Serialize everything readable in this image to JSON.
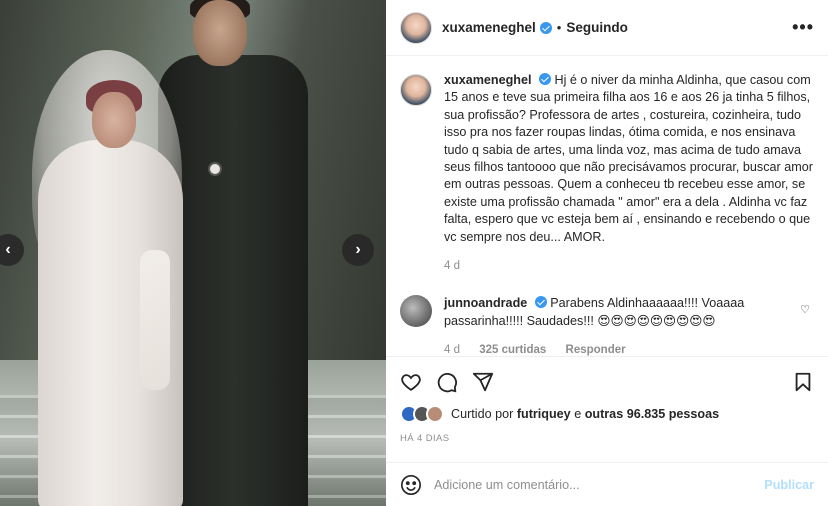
{
  "post": {
    "author": "xuxameneghel",
    "follow_status": "Seguindo",
    "separator": "•",
    "more": "•••",
    "nav_prev": "‹",
    "nav_next": "›"
  },
  "caption": {
    "author": "xuxameneghel",
    "text": "Hj é o niver da minha Aldinha, que casou com 15 anos e teve sua primeira filha aos 16 e aos 26 ja tinha 5 filhos, sua profissão? Professora de artes , costureira, cozinheira, tudo isso pra nos fazer roupas lindas, ótima comida, e nos ensinava tudo q sabia de artes, uma linda voz, mas acima de tudo amava seus filhos tantoooo que não precisávamos procurar, buscar amor em outras pessoas. Quem a conheceu tb recebeu esse amor, se existe uma profissão chamada \" amor\" era a dela . Aldinha vc faz falta, espero que vc esteja bem aí , ensinando e recebendo o que vc sempre nos deu... AMOR.",
    "age": "4 d"
  },
  "comment": {
    "author": "junnoandrade",
    "text": "Parabens Aldinhaaaaaa!!!! Voaaaa passarinha!!!!! Saudades!!! 😍😍😍😍😍😍😍😍😍",
    "age": "4 d",
    "likes": "325 curtidas",
    "reply": "Responder",
    "heart": "♡"
  },
  "likes": {
    "prefix": "Curtido por",
    "user": "futriquey",
    "middle": "e",
    "others": "outras 96.835 pessoas"
  },
  "timestamp": "HÁ 4 DIAS",
  "add_comment": {
    "placeholder": "Adicione um comentário...",
    "publish": "Publicar"
  },
  "colors": {
    "verified": "#3897f0",
    "muted": "#8e8e8e",
    "publish_disabled": "#b2dffc"
  }
}
